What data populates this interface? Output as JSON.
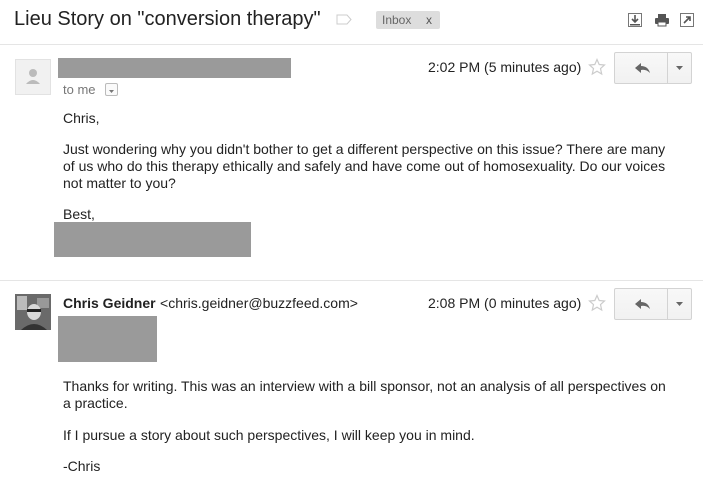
{
  "thread": {
    "subject": "Lieu Story on \"conversion therapy\"",
    "label_chip": "Inbox",
    "label_remove": "x"
  },
  "icons": [
    "download-icon",
    "print-icon",
    "new-window-icon",
    "label-icon",
    "star-icon",
    "reply-icon",
    "chevron-down-icon"
  ],
  "message1": {
    "to_line": "to me",
    "time": "2:02 PM (5 minutes ago)",
    "greeting": "Chris,",
    "paragraph": "Just wondering why you didn't bother to get a different perspective on this issue? There are many of us who do this therapy ethically and safely and have come out of homosexuality. Do our voices not matter to you?",
    "signoff": "Best,"
  },
  "message2": {
    "sender_name": "Chris Geidner",
    "sender_email": "<chris.geidner@buzzfeed.com>",
    "time": "2:08 PM (0 minutes ago)",
    "paragraph1": "Thanks for writing. This was an interview with a bill sponsor, not an analysis of all perspectives on a practice.",
    "paragraph2": "If I pursue a story about such perspectives, I will keep you in mind.",
    "signature": "-Chris"
  }
}
